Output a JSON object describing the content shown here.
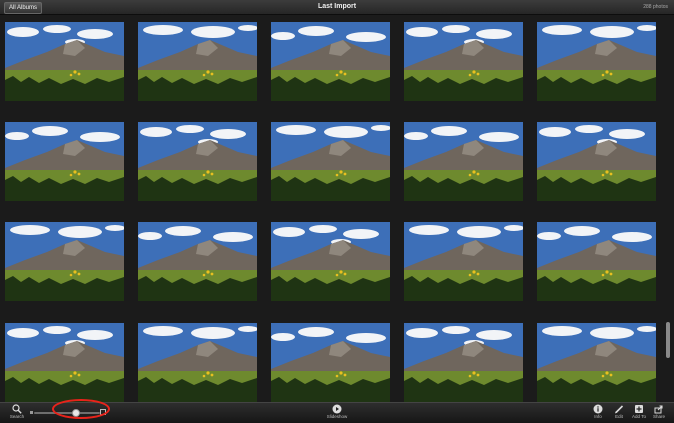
{
  "titlebar": {
    "back_label": "All Albums",
    "title": "Last Import",
    "photo_count": "288 photos"
  },
  "grid": {
    "columns": 5,
    "rows": 4,
    "thumbnail": "mountain-landscape-photo",
    "colors": {
      "sky": "#3d6fb8",
      "cloud": "#f2f4f7",
      "mountain": "#6f665d",
      "meadow": "#6e8a2e",
      "trees": "#1f3413",
      "flowers": "#e8c020"
    }
  },
  "toolbar": {
    "search_label": "Search",
    "slideshow_label": "Slideshow",
    "info_label": "Info",
    "edit_label": "Edit",
    "add_to_label": "Add To",
    "share_label": "Share"
  },
  "zoom_slider": {
    "value": 0.68
  },
  "annotation": {
    "highlight_color": "#e8231b"
  }
}
